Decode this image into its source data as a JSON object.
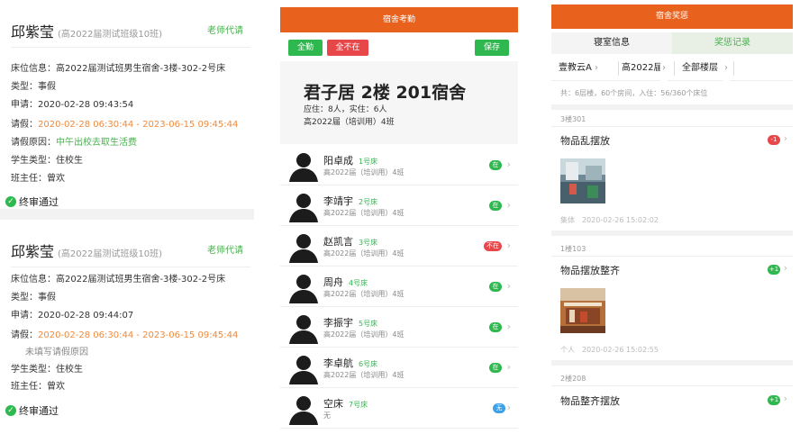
{
  "leave_records": [
    {
      "name": "邱紫莹",
      "class": "(高2022届测试班级10班)",
      "proxy": "老师代请",
      "bed_label": "床位信息：",
      "bed": "高2022届测试班男生宿舍-3楼-302-2号床",
      "type_label": "类型：",
      "type": "事假",
      "apply_label": "申请：",
      "apply_time": "2020-02-28 09:43:54",
      "leave_label": "请假：",
      "leave_range": "2020-02-28 06:30:44 - 2023-06-15 09:45:44",
      "reason_label": "请假原因：",
      "reason": "中午出校去取生活费",
      "student_type_label": "学生类型：",
      "student_type": "住校生",
      "teacher_label": "班主任：",
      "teacher": "曾欢",
      "status": "终审通过"
    },
    {
      "name": "邱紫莹",
      "class": "(高2022届测试班级10班)",
      "proxy": "老师代请",
      "bed_label": "床位信息：",
      "bed": "高2022届测试班男生宿舍-3楼-302-2号床",
      "type_label": "类型：",
      "type": "事假",
      "apply_label": "申请：",
      "apply_time": "2020-02-28 09:44:07",
      "leave_label": "请假：",
      "leave_range": "2020-02-28 06:30:44 - 2023-06-15 09:45:44",
      "reason_note": "未填写请假原因",
      "student_type_label": "学生类型：",
      "student_type": "住校生",
      "teacher_label": "班主任：",
      "teacher": "曾欢",
      "status": "终审通过"
    }
  ],
  "attendance": {
    "title": "宿舍考勤",
    "buttons": {
      "all": "全勤",
      "none": "全不在",
      "save": "保存"
    },
    "dorm": {
      "name": "君子居 2楼 201宿舍",
      "count": "应住：8人，实住：6人",
      "class": "高2022届（培训用）4班"
    },
    "students": [
      {
        "name": "阳卓成",
        "bed": "1号床",
        "class": "高2022届（培训用）4班",
        "status": "在",
        "state": "in"
      },
      {
        "name": "李靖宇",
        "bed": "2号床",
        "class": "高2022届（培训用）4班",
        "status": "在",
        "state": "in"
      },
      {
        "name": "赵凯言",
        "bed": "3号床",
        "class": "高2022届（培训用）4班",
        "status": "不在",
        "state": "out"
      },
      {
        "name": "周舟",
        "bed": "4号床",
        "class": "高2022届（培训用）4班",
        "status": "在",
        "state": "in"
      },
      {
        "name": "李振宇",
        "bed": "5号床",
        "class": "高2022届（培训用）4班",
        "status": "在",
        "state": "in"
      },
      {
        "name": "李卓航",
        "bed": "6号床",
        "class": "高2022届（培训用）4班",
        "status": "在",
        "state": "in"
      },
      {
        "name": "空床",
        "bed": "7号床",
        "class": "无",
        "status": "无",
        "state": "none"
      }
    ]
  },
  "rewards": {
    "title": "宿舍奖惩",
    "tabs": {
      "info": "寝室信息",
      "records": "奖惩记录"
    },
    "filters": {
      "school": "壹教云A",
      "grade": "高2022届",
      "building": "全部楼层"
    },
    "summary": "共：6层楼，60个房间，入住：56/360个床位",
    "records": [
      {
        "room": "3楼301",
        "title": "物品乱摆放",
        "score": "-1",
        "meta": "集体　2020-02-26 15:02:02"
      },
      {
        "room": "1楼103",
        "title": "物品摆放整齐",
        "score": "+1",
        "meta": "个人　2020-02-26 15:02:55"
      },
      {
        "room": "2楼208",
        "title": "物品整齐摆放",
        "score": "+1"
      }
    ]
  },
  "colors": {
    "orange": "#e8621e",
    "green": "#2fb84f",
    "red": "#e8474a",
    "highlight": "#f08a3c"
  }
}
